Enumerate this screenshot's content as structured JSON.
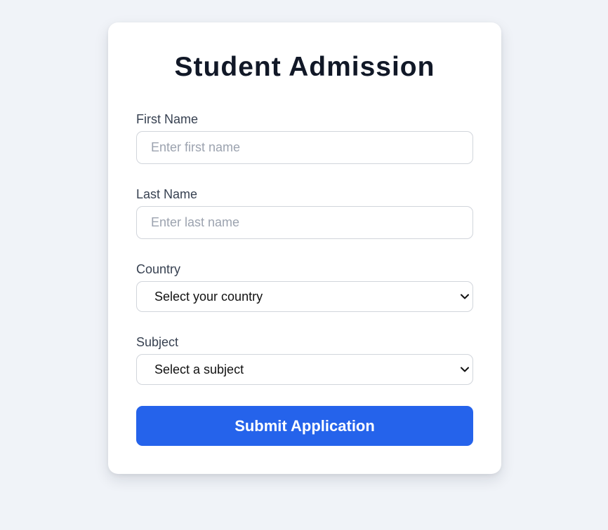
{
  "form": {
    "title": "Student Admission",
    "first_name": {
      "label": "First Name",
      "placeholder": "Enter first name",
      "value": ""
    },
    "last_name": {
      "label": "Last Name",
      "placeholder": "Enter last name",
      "value": ""
    },
    "country": {
      "label": "Country",
      "selected": "Select your country",
      "icon": "chevron-down-icon"
    },
    "subject": {
      "label": "Subject",
      "selected": "Select a subject",
      "icon": "chevron-down-icon"
    },
    "submit_label": "Submit Application"
  },
  "colors": {
    "background": "#f0f3f8",
    "card": "#ffffff",
    "title": "#111827",
    "label": "#374151",
    "placeholder": "#9ca3af",
    "border": "#d1d5db",
    "primary": "#2563eb"
  }
}
